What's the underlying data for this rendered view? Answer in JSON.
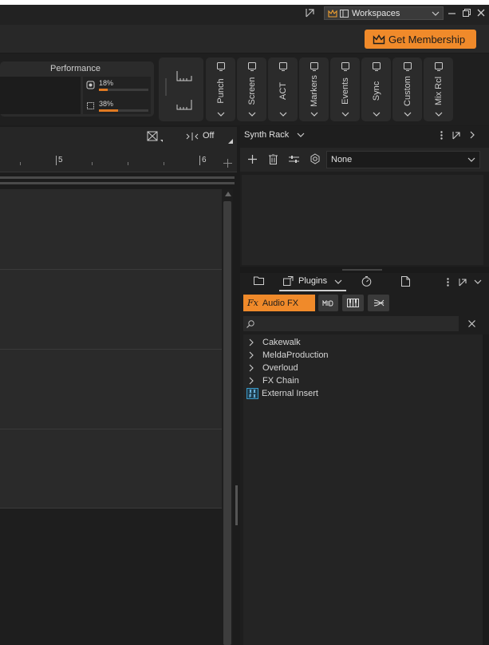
{
  "titlebar": {
    "workspaces_label": "Workspaces"
  },
  "membership": {
    "label": "Get Membership",
    "accent_color": "#f08a2a"
  },
  "performance": {
    "title": "Performance",
    "cpu_percent": "18%",
    "cpu_fraction": 0.18,
    "disk_percent": "38%",
    "disk_fraction": 0.38
  },
  "control_modules": [
    {
      "label": "Punch"
    },
    {
      "label": "Screen"
    },
    {
      "label": "ACT"
    },
    {
      "label": "Markers"
    },
    {
      "label": "Events"
    },
    {
      "label": "Sync"
    },
    {
      "label": "Custom"
    },
    {
      "label": "Mix Rcl"
    }
  ],
  "track_header": {
    "snap_label": "Off"
  },
  "ruler": {
    "marks": [
      "5",
      "6"
    ]
  },
  "synth_rack": {
    "title": "Synth Rack",
    "preset_value": "None"
  },
  "browser": {
    "active_tab_label": "Plugins",
    "audio_fx_label": "Audio FX",
    "search_placeholder": "",
    "tree_items": [
      {
        "label": "Cakewalk",
        "type": "folder"
      },
      {
        "label": "MeldaProduction",
        "type": "folder"
      },
      {
        "label": "Overloud",
        "type": "folder"
      },
      {
        "label": "FX Chain",
        "type": "folder"
      },
      {
        "label": "External Insert",
        "type": "plugin"
      }
    ]
  }
}
